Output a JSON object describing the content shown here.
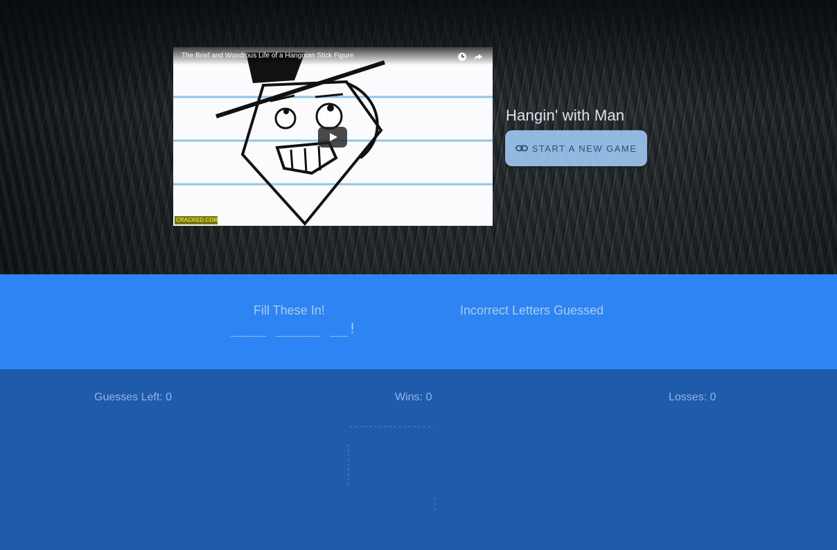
{
  "video": {
    "title": "The Brief and Wondrous Life of a Hangman Stick Figure",
    "logo_text": "CRACKED.COM",
    "icons": [
      "clock-icon",
      "share-icon",
      "play-icon"
    ]
  },
  "header": {
    "title": "Hangin' with Man",
    "start_button_label": "START A NEW GAME",
    "start_button_icon": "link-icon"
  },
  "letters": {
    "fill_heading": "Fill These In!",
    "blanks": "____ _____ __!",
    "incorrect_heading": "Incorrect Letters Guessed",
    "incorrect_letters": ""
  },
  "stats": {
    "guesses_left": "Guesses Left: 0",
    "wins": "Wins: 0",
    "losses": "Losses: 0"
  },
  "colors": {
    "letters_band": "#2f84f3",
    "stats_band": "#1f5aab",
    "button_bg": "#9cc4f0"
  }
}
